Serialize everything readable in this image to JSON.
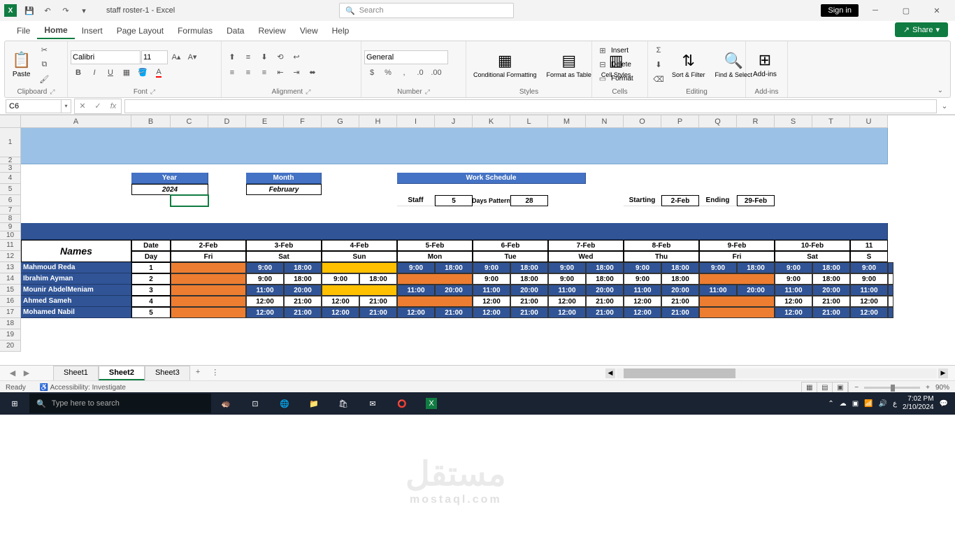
{
  "titlebar": {
    "title": "staff roster-1 - Excel",
    "search_placeholder": "Search",
    "signin": "Sign in"
  },
  "tabs": {
    "file": "File",
    "home": "Home",
    "insert": "Insert",
    "pagelayout": "Page Layout",
    "formulas": "Formulas",
    "data": "Data",
    "review": "Review",
    "view": "View",
    "help": "Help",
    "share": "Share"
  },
  "ribbon": {
    "clipboard": {
      "label": "Clipboard",
      "paste": "Paste"
    },
    "font": {
      "label": "Font",
      "name": "Calibri",
      "size": "11"
    },
    "alignment": {
      "label": "Alignment"
    },
    "number": {
      "label": "Number",
      "format": "General"
    },
    "styles": {
      "label": "Styles",
      "cond": "Conditional Formatting",
      "table": "Format as Table",
      "cell": "Cell Styles"
    },
    "cells": {
      "label": "Cells",
      "insert": "Insert",
      "delete": "Delete",
      "format": "Format"
    },
    "editing": {
      "label": "Editing",
      "sort": "Sort & Filter",
      "find": "Find & Select"
    },
    "addins": {
      "label": "Add-ins",
      "btn": "Add-ins"
    }
  },
  "formula_bar": {
    "cell_ref": "C6"
  },
  "columns": [
    "A",
    "B",
    "C",
    "D",
    "E",
    "F",
    "G",
    "H",
    "I",
    "J",
    "K",
    "L",
    "M",
    "N",
    "O",
    "P",
    "Q",
    "R",
    "S",
    "T",
    "U"
  ],
  "rowheights": {
    "default": 16,
    "r1": 42,
    "r2": 10
  },
  "sheet": {
    "year_label": "Year",
    "year_value": "2024",
    "month_label": "Month",
    "month_value": "February",
    "ws_label": "Work Schedule",
    "staff_label": "Staff",
    "staff_value": "5",
    "days_label": "Days Pattern",
    "days_value": "28",
    "starting_label": "Starting",
    "starting_value": "2-Feb",
    "ending_label": "Ending",
    "ending_value": "29-Feb",
    "names_hdr": "Names",
    "date_hdr": "Date",
    "day_hdr": "Day",
    "dates": [
      "2-Feb",
      "3-Feb",
      "4-Feb",
      "5-Feb",
      "6-Feb",
      "7-Feb",
      "8-Feb",
      "9-Feb",
      "10-Feb",
      "11"
    ],
    "days": [
      "Fri",
      "Sat",
      "Sun",
      "Mon",
      "Tue",
      "Wed",
      "Thu",
      "Fri",
      "Sat",
      "S"
    ],
    "staff": [
      {
        "name": "Mahmoud Reda",
        "num": "1",
        "row": [
          [
            "",
            ""
          ],
          [
            "9:00",
            "18:00"
          ],
          [
            "",
            ""
          ],
          [
            "9:00",
            "18:00"
          ],
          [
            "9:00",
            "18:00"
          ],
          [
            "9:00",
            "18:00"
          ],
          [
            "9:00",
            "18:00"
          ],
          [
            "9:00",
            "18:00"
          ],
          [
            "9:00",
            "18:00"
          ],
          [
            "9:00",
            ""
          ]
        ],
        "off": [
          0,
          2
        ]
      },
      {
        "name": "Ibrahim Ayman",
        "num": "2",
        "row": [
          [
            "",
            ""
          ],
          [
            "9:00",
            "18:00"
          ],
          [
            "9:00",
            "18:00"
          ],
          [
            "",
            ""
          ],
          [
            "9:00",
            "18:00"
          ],
          [
            "9:00",
            "18:00"
          ],
          [
            "9:00",
            "18:00"
          ],
          [
            "",
            ""
          ],
          [
            "9:00",
            "18:00"
          ],
          [
            "9:00",
            ""
          ]
        ],
        "off": [
          0,
          3,
          7
        ]
      },
      {
        "name": "Mounir AbdelMeniam",
        "num": "3",
        "row": [
          [
            "",
            ""
          ],
          [
            "11:00",
            "20:00"
          ],
          [
            "",
            ""
          ],
          [
            "11:00",
            "20:00"
          ],
          [
            "11:00",
            "20:00"
          ],
          [
            "11:00",
            "20:00"
          ],
          [
            "11:00",
            "20:00"
          ],
          [
            "11:00",
            "20:00"
          ],
          [
            "11:00",
            "20:00"
          ],
          [
            "11:00",
            ""
          ]
        ],
        "off": [
          0,
          2
        ]
      },
      {
        "name": "Ahmed Sameh",
        "num": "4",
        "row": [
          [
            "",
            ""
          ],
          [
            "12:00",
            "21:00"
          ],
          [
            "12:00",
            "21:00"
          ],
          [
            "",
            ""
          ],
          [
            "12:00",
            "21:00"
          ],
          [
            "12:00",
            "21:00"
          ],
          [
            "12:00",
            "21:00"
          ],
          [
            "",
            ""
          ],
          [
            "12:00",
            "21:00"
          ],
          [
            "12:00",
            ""
          ]
        ],
        "off": [
          0,
          3,
          7
        ]
      },
      {
        "name": "Mohamed Nabil",
        "num": "5",
        "row": [
          [
            "",
            ""
          ],
          [
            "12:00",
            "21:00"
          ],
          [
            "12:00",
            "21:00"
          ],
          [
            "12:00",
            "21:00"
          ],
          [
            "12:00",
            "21:00"
          ],
          [
            "12:00",
            "21:00"
          ],
          [
            "12:00",
            "21:00"
          ],
          [
            "",
            ""
          ],
          [
            "12:00",
            "21:00"
          ],
          [
            "12:00",
            ""
          ]
        ],
        "off": [
          0,
          7
        ]
      }
    ]
  },
  "sheettabs": {
    "t1": "Sheet1",
    "t2": "Sheet2",
    "t3": "Sheet3"
  },
  "statusbar": {
    "ready": "Ready",
    "access": "Accessibility: Investigate",
    "zoom": "90%"
  },
  "taskbar": {
    "search_placeholder": "Type here to search",
    "time": "7:02 PM",
    "date": "2/10/2024"
  },
  "watermark": {
    "main": "مستقل",
    "sub": "mostaql.com"
  },
  "colw": {
    "A": 158,
    "B": 56,
    "narrow": 54
  }
}
